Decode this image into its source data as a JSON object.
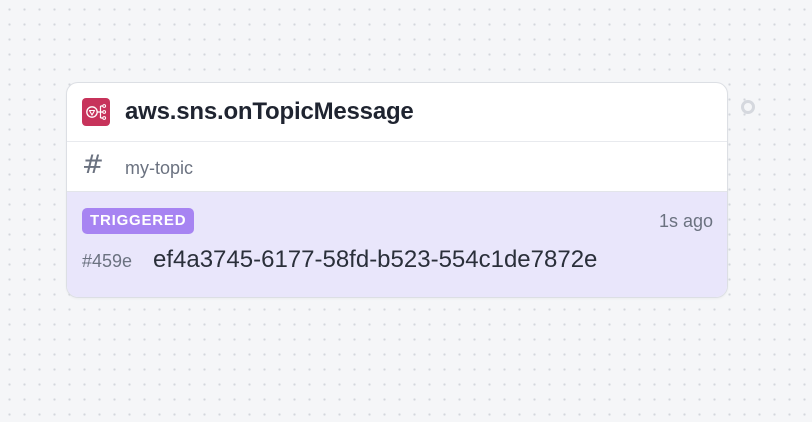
{
  "node": {
    "icon": "aws-sns-icon",
    "title": "aws.sns.onTopicMessage",
    "config": {
      "icon": "hash-icon",
      "value": "my-topic"
    },
    "event": {
      "status": "TRIGGERED",
      "time": "1s ago",
      "short_id": "#459e",
      "id": "ef4a3745-6177-58fd-b523-554c1de7872e"
    }
  },
  "colors": {
    "badge": "#a784f2",
    "panel": "#e9e6fb",
    "icon": "#c7335b"
  }
}
